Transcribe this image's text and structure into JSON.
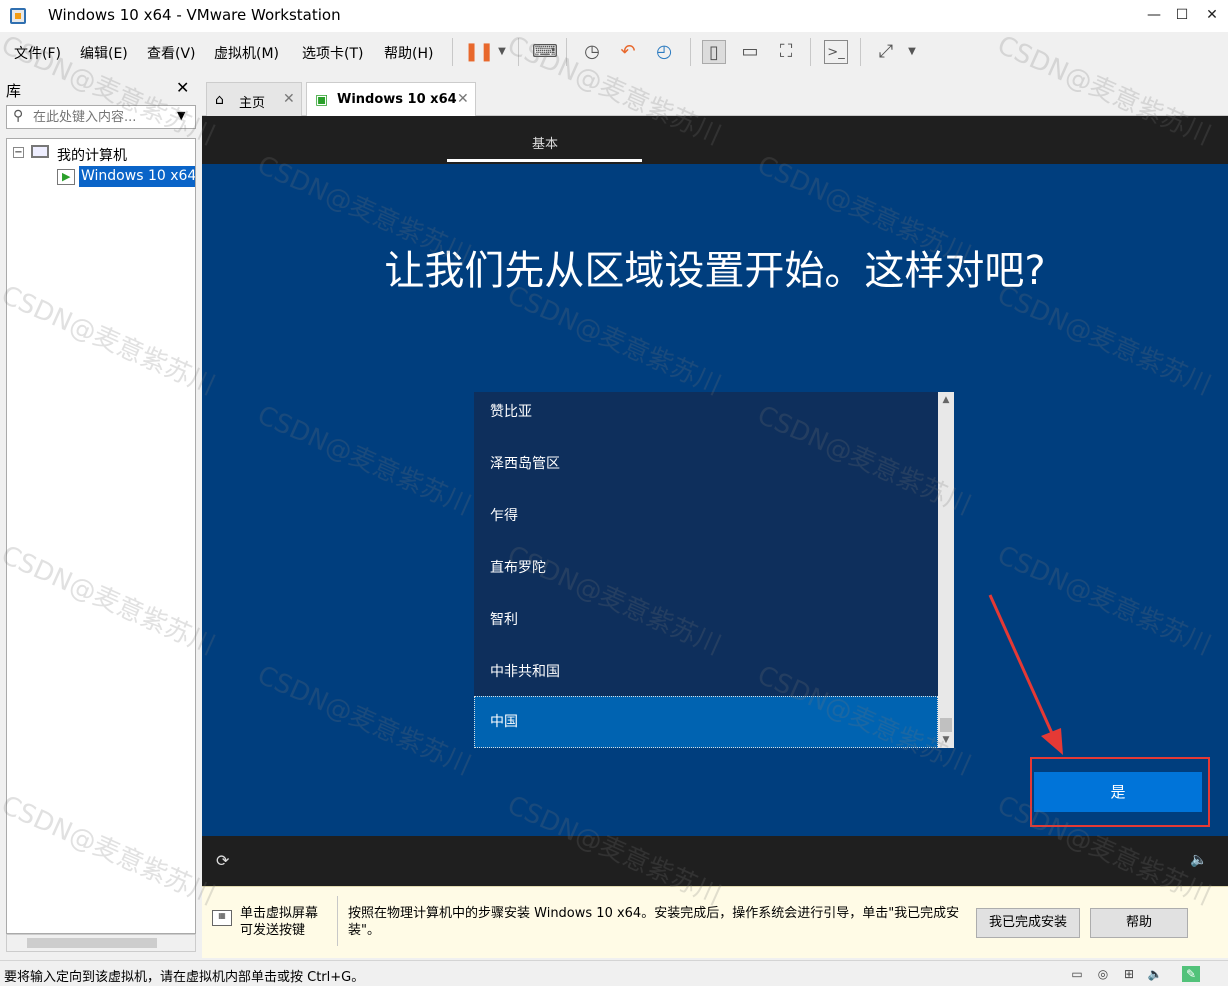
{
  "window": {
    "title": "Windows 10 x64 - VMware Workstation",
    "minimize_glyph": "—",
    "maximize_glyph": "☐",
    "close_glyph": "✕"
  },
  "menu": [
    "文件(F)",
    "编辑(E)",
    "查看(V)",
    "虚拟机(M)",
    "选项卡(T)",
    "帮助(H)"
  ],
  "toolbar": {
    "icons": [
      "pause-icon",
      "dropdown-icon",
      "send-ctrl-alt-del-icon",
      "snapshot-icon",
      "revert-snapshot-icon",
      "snapshot-manager-icon",
      "show-library-icon",
      "thumbnail-bar-icon",
      "fullscreen-icon",
      "console-view-icon",
      "stretch-icon"
    ]
  },
  "library": {
    "title": "库",
    "search_placeholder": "在此处键入内容...",
    "tree": {
      "root": "我的计算机",
      "vm": "Windows 10 x64"
    }
  },
  "tabs": [
    {
      "label": "主页",
      "icon": "home-icon",
      "active": false
    },
    {
      "label": "Windows 10 x64",
      "icon": "vm-icon",
      "active": true
    }
  ],
  "vm_screen": {
    "step_label": "基本",
    "heading": "让我们先从区域设置开始。这样对吧?",
    "regions": [
      "赞比亚",
      "泽西岛管区",
      "乍得",
      "直布罗陀",
      "智利",
      "中非共和国",
      "中国"
    ],
    "selected_region": "中国",
    "yes_button": "是",
    "colors": {
      "background": "#003e7e",
      "accent": "#0074d9",
      "highlight": "#e53935"
    }
  },
  "hint": {
    "click_text": "单击虚拟屏幕\n可发送按键",
    "main_text": "按照在物理计算机中的步骤安装 Windows 10 x64。安装完成后，操作系统会进行引导，单击\"我已完成安装\"。",
    "done_button": "我已完成安装",
    "help_button": "帮助"
  },
  "statusbar": {
    "text": "要将输入定向到该虚拟机，请在虚拟机内部单击或按 Ctrl+G。"
  },
  "watermark": "CSDN@麦意紫苏川"
}
